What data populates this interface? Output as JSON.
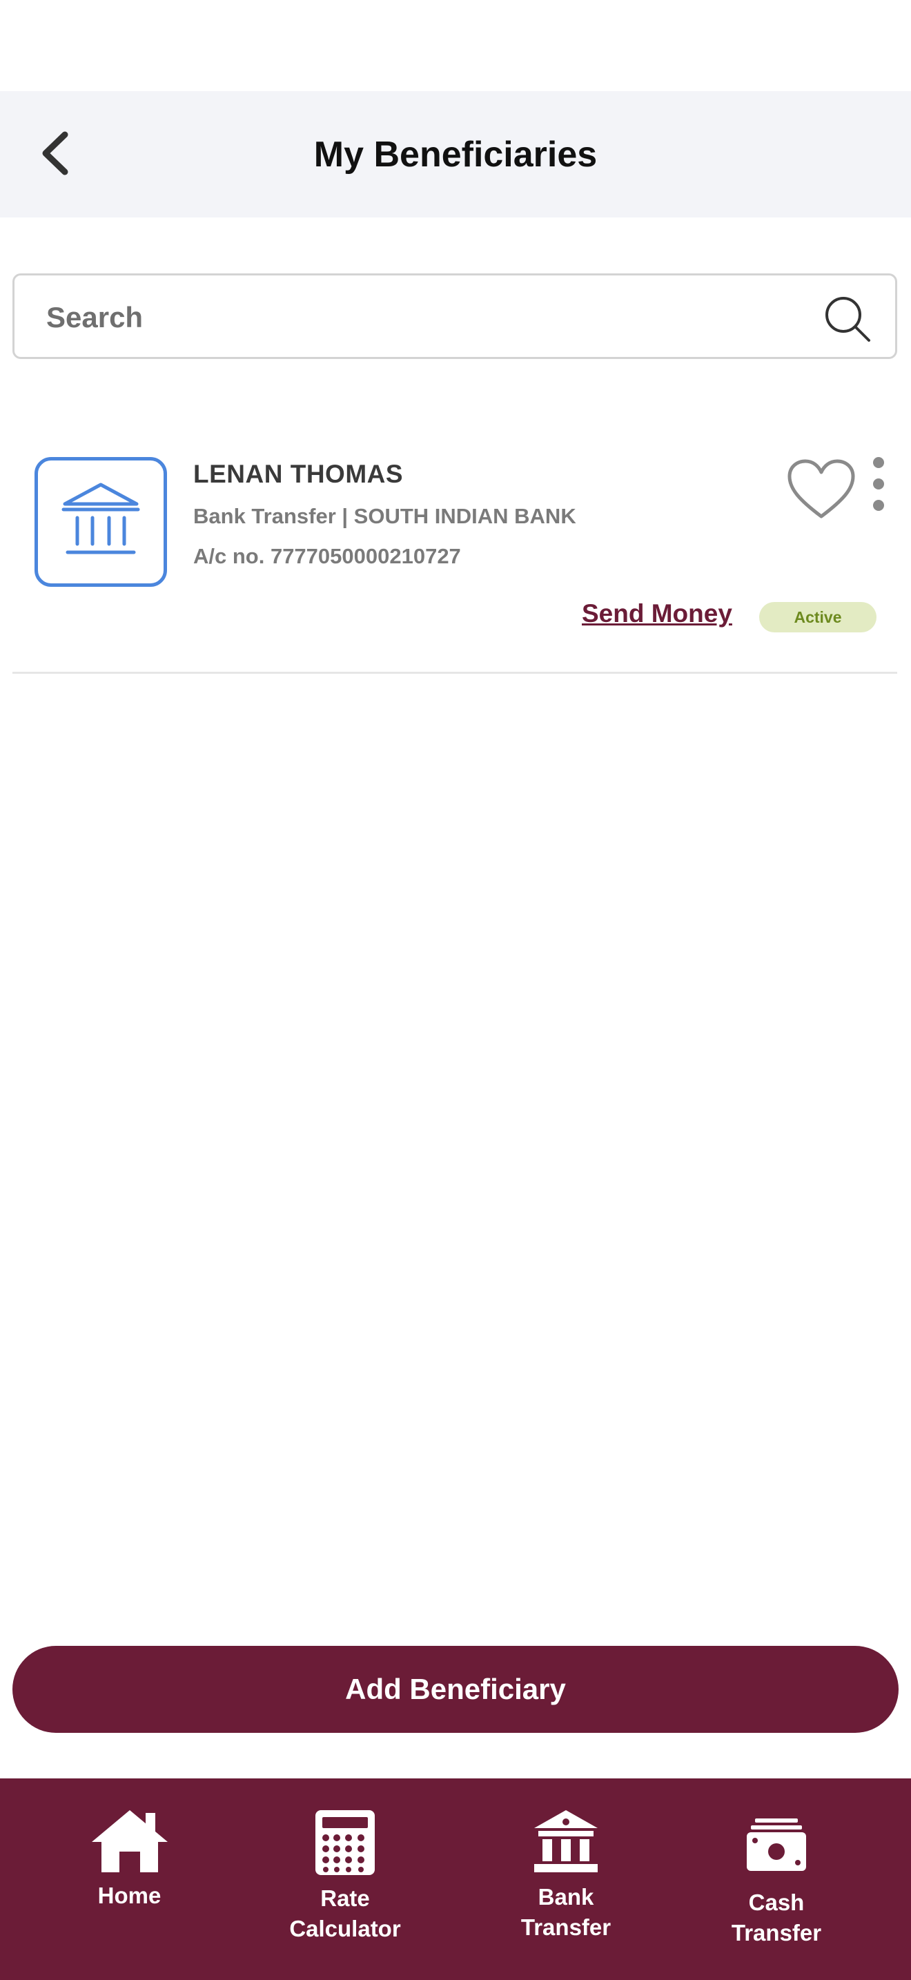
{
  "header": {
    "title": "My Beneficiaries"
  },
  "search": {
    "placeholder": "Search",
    "value": ""
  },
  "beneficiaries": [
    {
      "name": "LENAN THOMAS",
      "subtitle": "Bank Transfer | SOUTH INDIAN BANK",
      "account": "A/c no. 7777050000210727",
      "action_label": "Send Money",
      "status": "Active",
      "icon": "bank-icon"
    }
  ],
  "add_button": {
    "label": "Add Beneficiary"
  },
  "bottom_nav": {
    "items": [
      {
        "label": "Home",
        "icon": "home-icon"
      },
      {
        "label": "Rate\nCalculator",
        "icon": "calculator-icon"
      },
      {
        "label": "Bank\nTransfer",
        "icon": "bank-icon"
      },
      {
        "label": "Cash\nTransfer",
        "icon": "cash-icon"
      }
    ]
  },
  "colors": {
    "brand": "#6b1c37",
    "header_bg": "#f3f4f8",
    "accent_blue": "#4b86dd",
    "status_active_bg": "#e3ebc3",
    "status_active_text": "#6d8a1f"
  }
}
